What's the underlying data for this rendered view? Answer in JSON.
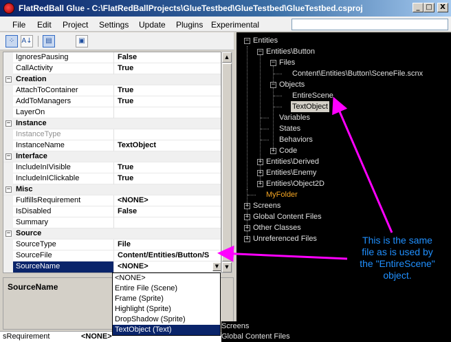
{
  "window": {
    "title": "FlatRedBall Glue - C:\\FlatRedBallProjects\\GlueTestbed\\GlueTestbed\\GlueTestbed.csproj",
    "min_glyph": "_",
    "max_glyph": "□",
    "close_glyph": "X"
  },
  "menu": {
    "items": [
      "File",
      "Edit",
      "Project",
      "Settings",
      "Update",
      "Plugins",
      "Experimental"
    ]
  },
  "toolbar": {
    "icons": [
      "categorized-icon",
      "alphabetical-icon",
      "properties-icon",
      "property-pages-icon"
    ],
    "glyphs": [
      "⁘",
      "A↓",
      "▤",
      "▣"
    ]
  },
  "property_grid": {
    "rows": [
      {
        "type": "prop",
        "name": "IgnoresPausing",
        "value": "False"
      },
      {
        "type": "prop",
        "name": "CallActivity",
        "value": "True"
      },
      {
        "type": "cat",
        "name": "Creation",
        "expander": "−"
      },
      {
        "type": "prop",
        "name": "AttachToContainer",
        "value": "True"
      },
      {
        "type": "prop",
        "name": "AddToManagers",
        "value": "True"
      },
      {
        "type": "prop",
        "name": "LayerOn",
        "value": ""
      },
      {
        "type": "cat",
        "name": "Instance",
        "expander": "−"
      },
      {
        "type": "prop",
        "name": "InstanceType",
        "value": "",
        "dim": true
      },
      {
        "type": "prop",
        "name": "InstanceName",
        "value": "TextObject"
      },
      {
        "type": "cat",
        "name": "Interface",
        "expander": "−"
      },
      {
        "type": "prop",
        "name": "IncludeInIVisible",
        "value": "True"
      },
      {
        "type": "prop",
        "name": "IncludeInIClickable",
        "value": "True"
      },
      {
        "type": "cat",
        "name": "Misc",
        "expander": "−"
      },
      {
        "type": "prop",
        "name": "FulfillsRequirement",
        "value": "<NONE>"
      },
      {
        "type": "prop",
        "name": "IsDisabled",
        "value": "False"
      },
      {
        "type": "prop",
        "name": "Summary",
        "value": ""
      },
      {
        "type": "cat",
        "name": "Source",
        "expander": "−"
      },
      {
        "type": "prop",
        "name": "SourceType",
        "value": "File"
      },
      {
        "type": "prop",
        "name": "SourceFile",
        "value": "Content/Entities/Button/S"
      },
      {
        "type": "prop",
        "name": "SourceName",
        "value": "<NONE>",
        "selected": true
      }
    ],
    "dropdown_glyph": "▼"
  },
  "scrollbar": {
    "up": "▲",
    "down": "▼"
  },
  "description": {
    "title": "SourceName"
  },
  "bottom_row": {
    "name": "sRequirement",
    "value": "<NONE>"
  },
  "dropdown": {
    "options": [
      "<NONE>",
      "Entire File (Scene)",
      "Frame (Sprite)",
      "Highlight (Sprite)",
      "DropShadow (Sprite)",
      "TextObject (Text)"
    ],
    "selected_index": 5
  },
  "tree": {
    "nodes": [
      {
        "label": "Entities",
        "level": 0,
        "exp": "−"
      },
      {
        "label": "Entities\\Button",
        "level": 1,
        "exp": "−"
      },
      {
        "label": "Files",
        "level": 2,
        "exp": "−"
      },
      {
        "label": "Content\\Entities\\Button\\SceneFile.scnx",
        "level": 3,
        "exp": ""
      },
      {
        "label": "Objects",
        "level": 2,
        "exp": "−"
      },
      {
        "label": "EntireScene",
        "level": 3,
        "exp": ""
      },
      {
        "label": "TextObject",
        "level": 3,
        "exp": "",
        "selected": true
      },
      {
        "label": "Variables",
        "level": 2,
        "exp": ""
      },
      {
        "label": "States",
        "level": 2,
        "exp": ""
      },
      {
        "label": "Behaviors",
        "level": 2,
        "exp": ""
      },
      {
        "label": "Code",
        "level": 2,
        "exp": "+"
      },
      {
        "label": "Entities\\Derived",
        "level": 1,
        "exp": "+"
      },
      {
        "label": "Entities\\Enemy",
        "level": 1,
        "exp": "+"
      },
      {
        "label": "Entities\\Object2D",
        "level": 1,
        "exp": "+"
      },
      {
        "label": "MyFolder",
        "level": 1,
        "exp": "",
        "orange": true
      },
      {
        "label": "Screens",
        "level": 0,
        "exp": "+"
      },
      {
        "label": "Global Content Files",
        "level": 0,
        "exp": "+"
      },
      {
        "label": "Other Classes",
        "level": 0,
        "exp": "+"
      },
      {
        "label": "Unreferenced Files",
        "level": 0,
        "exp": "+"
      }
    ],
    "bottom_nodes": [
      "Screens",
      "Global Content Files"
    ]
  },
  "annotation": {
    "text_lines": [
      "This is the same",
      "file as is used by",
      "the \"EntireScene\"",
      "object."
    ],
    "color": "#2090ff",
    "arrow_color": "#ff00ff"
  }
}
